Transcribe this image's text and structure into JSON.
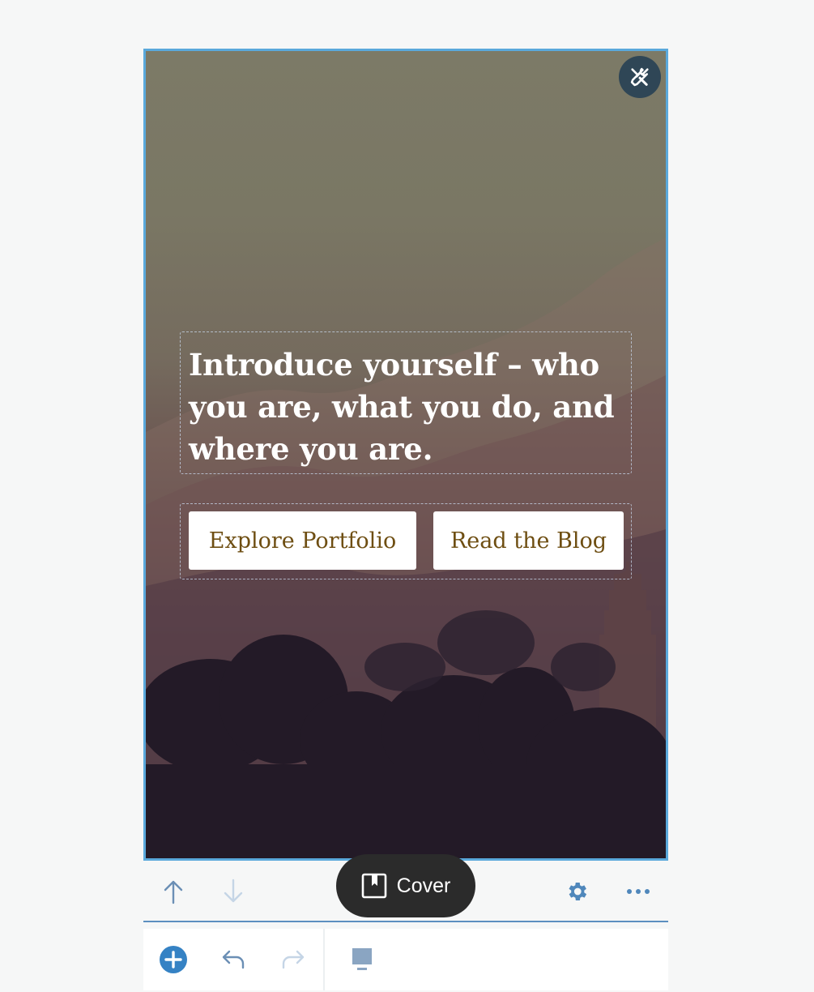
{
  "cover": {
    "heading": "Introduce yourself – who you are, what you do, and where you are.",
    "buttons": [
      {
        "label": "Explore Portfolio"
      },
      {
        "label": "Read the Blog"
      }
    ]
  },
  "toolbar": {
    "block_name": "Cover",
    "icons": [
      "arrow-up-icon",
      "arrow-down-icon",
      "gear-icon",
      "more-horizontal-icon"
    ]
  },
  "bottom_bar": {
    "icons": [
      "add-block-icon",
      "undo-icon",
      "redo-icon",
      "block-navigation-icon"
    ]
  },
  "colors": {
    "accent": "#3582c4",
    "selection_border": "#5aa9dc",
    "button_text": "#6e4e12",
    "pill_bg": "#2b2b2b",
    "fab_bg": "#2f4656"
  }
}
